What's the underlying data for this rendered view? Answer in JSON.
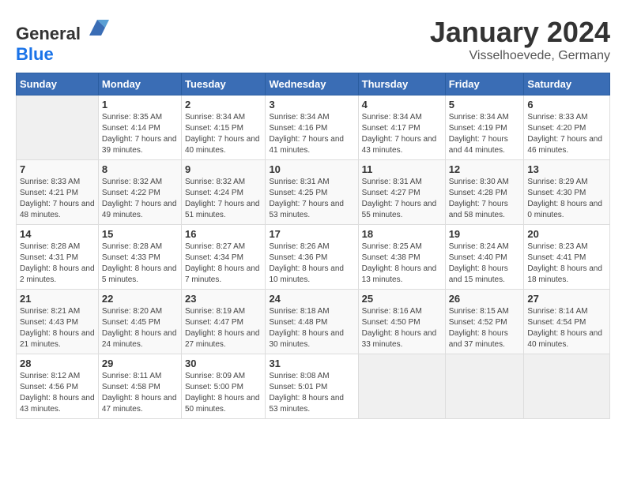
{
  "header": {
    "logo_general": "General",
    "logo_blue": "Blue",
    "month_title": "January 2024",
    "location": "Visselhoevede, Germany"
  },
  "days_of_week": [
    "Sunday",
    "Monday",
    "Tuesday",
    "Wednesday",
    "Thursday",
    "Friday",
    "Saturday"
  ],
  "weeks": [
    [
      {
        "day": "",
        "empty": true
      },
      {
        "day": "1",
        "sunrise": "Sunrise: 8:35 AM",
        "sunset": "Sunset: 4:14 PM",
        "daylight": "Daylight: 7 hours and 39 minutes."
      },
      {
        "day": "2",
        "sunrise": "Sunrise: 8:34 AM",
        "sunset": "Sunset: 4:15 PM",
        "daylight": "Daylight: 7 hours and 40 minutes."
      },
      {
        "day": "3",
        "sunrise": "Sunrise: 8:34 AM",
        "sunset": "Sunset: 4:16 PM",
        "daylight": "Daylight: 7 hours and 41 minutes."
      },
      {
        "day": "4",
        "sunrise": "Sunrise: 8:34 AM",
        "sunset": "Sunset: 4:17 PM",
        "daylight": "Daylight: 7 hours and 43 minutes."
      },
      {
        "day": "5",
        "sunrise": "Sunrise: 8:34 AM",
        "sunset": "Sunset: 4:19 PM",
        "daylight": "Daylight: 7 hours and 44 minutes."
      },
      {
        "day": "6",
        "sunrise": "Sunrise: 8:33 AM",
        "sunset": "Sunset: 4:20 PM",
        "daylight": "Daylight: 7 hours and 46 minutes."
      }
    ],
    [
      {
        "day": "7",
        "sunrise": "Sunrise: 8:33 AM",
        "sunset": "Sunset: 4:21 PM",
        "daylight": "Daylight: 7 hours and 48 minutes."
      },
      {
        "day": "8",
        "sunrise": "Sunrise: 8:32 AM",
        "sunset": "Sunset: 4:22 PM",
        "daylight": "Daylight: 7 hours and 49 minutes."
      },
      {
        "day": "9",
        "sunrise": "Sunrise: 8:32 AM",
        "sunset": "Sunset: 4:24 PM",
        "daylight": "Daylight: 7 hours and 51 minutes."
      },
      {
        "day": "10",
        "sunrise": "Sunrise: 8:31 AM",
        "sunset": "Sunset: 4:25 PM",
        "daylight": "Daylight: 7 hours and 53 minutes."
      },
      {
        "day": "11",
        "sunrise": "Sunrise: 8:31 AM",
        "sunset": "Sunset: 4:27 PM",
        "daylight": "Daylight: 7 hours and 55 minutes."
      },
      {
        "day": "12",
        "sunrise": "Sunrise: 8:30 AM",
        "sunset": "Sunset: 4:28 PM",
        "daylight": "Daylight: 7 hours and 58 minutes."
      },
      {
        "day": "13",
        "sunrise": "Sunrise: 8:29 AM",
        "sunset": "Sunset: 4:30 PM",
        "daylight": "Daylight: 8 hours and 0 minutes."
      }
    ],
    [
      {
        "day": "14",
        "sunrise": "Sunrise: 8:28 AM",
        "sunset": "Sunset: 4:31 PM",
        "daylight": "Daylight: 8 hours and 2 minutes."
      },
      {
        "day": "15",
        "sunrise": "Sunrise: 8:28 AM",
        "sunset": "Sunset: 4:33 PM",
        "daylight": "Daylight: 8 hours and 5 minutes."
      },
      {
        "day": "16",
        "sunrise": "Sunrise: 8:27 AM",
        "sunset": "Sunset: 4:34 PM",
        "daylight": "Daylight: 8 hours and 7 minutes."
      },
      {
        "day": "17",
        "sunrise": "Sunrise: 8:26 AM",
        "sunset": "Sunset: 4:36 PM",
        "daylight": "Daylight: 8 hours and 10 minutes."
      },
      {
        "day": "18",
        "sunrise": "Sunrise: 8:25 AM",
        "sunset": "Sunset: 4:38 PM",
        "daylight": "Daylight: 8 hours and 13 minutes."
      },
      {
        "day": "19",
        "sunrise": "Sunrise: 8:24 AM",
        "sunset": "Sunset: 4:40 PM",
        "daylight": "Daylight: 8 hours and 15 minutes."
      },
      {
        "day": "20",
        "sunrise": "Sunrise: 8:23 AM",
        "sunset": "Sunset: 4:41 PM",
        "daylight": "Daylight: 8 hours and 18 minutes."
      }
    ],
    [
      {
        "day": "21",
        "sunrise": "Sunrise: 8:21 AM",
        "sunset": "Sunset: 4:43 PM",
        "daylight": "Daylight: 8 hours and 21 minutes."
      },
      {
        "day": "22",
        "sunrise": "Sunrise: 8:20 AM",
        "sunset": "Sunset: 4:45 PM",
        "daylight": "Daylight: 8 hours and 24 minutes."
      },
      {
        "day": "23",
        "sunrise": "Sunrise: 8:19 AM",
        "sunset": "Sunset: 4:47 PM",
        "daylight": "Daylight: 8 hours and 27 minutes."
      },
      {
        "day": "24",
        "sunrise": "Sunrise: 8:18 AM",
        "sunset": "Sunset: 4:48 PM",
        "daylight": "Daylight: 8 hours and 30 minutes."
      },
      {
        "day": "25",
        "sunrise": "Sunrise: 8:16 AM",
        "sunset": "Sunset: 4:50 PM",
        "daylight": "Daylight: 8 hours and 33 minutes."
      },
      {
        "day": "26",
        "sunrise": "Sunrise: 8:15 AM",
        "sunset": "Sunset: 4:52 PM",
        "daylight": "Daylight: 8 hours and 37 minutes."
      },
      {
        "day": "27",
        "sunrise": "Sunrise: 8:14 AM",
        "sunset": "Sunset: 4:54 PM",
        "daylight": "Daylight: 8 hours and 40 minutes."
      }
    ],
    [
      {
        "day": "28",
        "sunrise": "Sunrise: 8:12 AM",
        "sunset": "Sunset: 4:56 PM",
        "daylight": "Daylight: 8 hours and 43 minutes."
      },
      {
        "day": "29",
        "sunrise": "Sunrise: 8:11 AM",
        "sunset": "Sunset: 4:58 PM",
        "daylight": "Daylight: 8 hours and 47 minutes."
      },
      {
        "day": "30",
        "sunrise": "Sunrise: 8:09 AM",
        "sunset": "Sunset: 5:00 PM",
        "daylight": "Daylight: 8 hours and 50 minutes."
      },
      {
        "day": "31",
        "sunrise": "Sunrise: 8:08 AM",
        "sunset": "Sunset: 5:01 PM",
        "daylight": "Daylight: 8 hours and 53 minutes."
      },
      {
        "day": "",
        "empty": true
      },
      {
        "day": "",
        "empty": true
      },
      {
        "day": "",
        "empty": true
      }
    ]
  ]
}
